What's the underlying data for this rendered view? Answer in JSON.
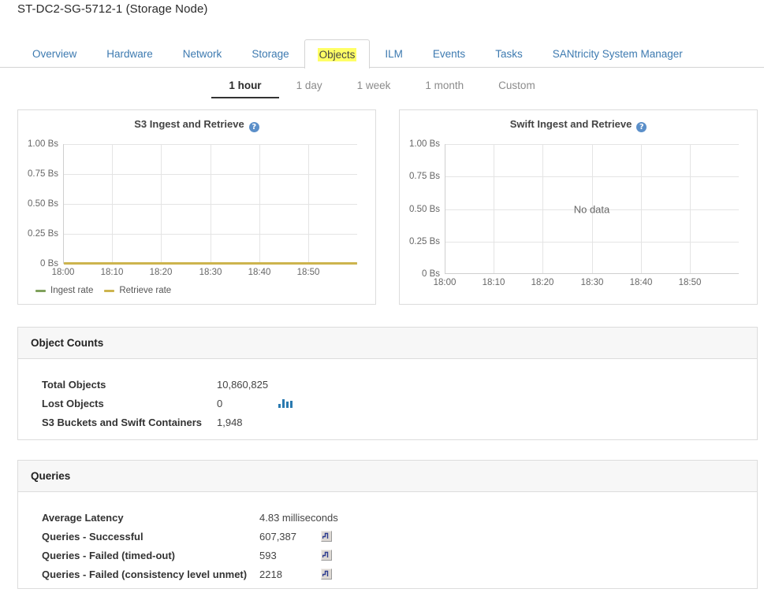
{
  "page": {
    "node_title": "ST-DC2-SG-5712-1 (Storage Node)"
  },
  "tabs": [
    {
      "label": "Overview",
      "active": false
    },
    {
      "label": "Hardware",
      "active": false
    },
    {
      "label": "Network",
      "active": false
    },
    {
      "label": "Storage",
      "active": false
    },
    {
      "label": "Objects",
      "active": true
    },
    {
      "label": "ILM",
      "active": false
    },
    {
      "label": "Events",
      "active": false
    },
    {
      "label": "Tasks",
      "active": false
    },
    {
      "label": "SANtricity System Manager",
      "active": false
    }
  ],
  "time_range": {
    "options": [
      {
        "label": "1 hour",
        "active": true
      },
      {
        "label": "1 day",
        "active": false
      },
      {
        "label": "1 week",
        "active": false
      },
      {
        "label": "1 month",
        "active": false
      },
      {
        "label": "Custom",
        "active": false
      }
    ]
  },
  "chart_data": [
    {
      "type": "line",
      "title": "S3 Ingest and Retrieve",
      "help_glyph": "?",
      "xlabel": "",
      "ylabel": "",
      "ylim": [
        0,
        1
      ],
      "yticks": [
        "0 Bs",
        "0.25 Bs",
        "0.50 Bs",
        "0.75 Bs",
        "1.00 Bs"
      ],
      "ytick_values": [
        0,
        0.25,
        0.5,
        0.75,
        1.0
      ],
      "xticks": [
        "18:00",
        "18:10",
        "18:20",
        "18:30",
        "18:40",
        "18:50"
      ],
      "xtick_positions": [
        0,
        0.167,
        0.333,
        0.5,
        0.667,
        0.833
      ],
      "grid": true,
      "legend_position": "bottom-left",
      "series": [
        {
          "name": "Ingest rate",
          "color": "#7fa15c",
          "values": [
            0,
            0,
            0,
            0,
            0,
            0,
            0
          ]
        },
        {
          "name": "Retrieve rate",
          "color": "#cdb44e",
          "values": [
            0,
            0,
            0,
            0,
            0,
            0,
            0
          ]
        }
      ],
      "no_data": false
    },
    {
      "type": "line",
      "title": "Swift Ingest and Retrieve",
      "help_glyph": "?",
      "xlabel": "",
      "ylabel": "",
      "ylim": [
        0,
        1
      ],
      "yticks": [
        "0 Bs",
        "0.25 Bs",
        "0.50 Bs",
        "0.75 Bs",
        "1.00 Bs"
      ],
      "ytick_values": [
        0,
        0.25,
        0.5,
        0.75,
        1.0
      ],
      "xticks": [
        "18:00",
        "18:10",
        "18:20",
        "18:30",
        "18:40",
        "18:50"
      ],
      "xtick_positions": [
        0,
        0.167,
        0.333,
        0.5,
        0.667,
        0.833
      ],
      "grid": true,
      "legend_position": "none",
      "series": [],
      "no_data": true,
      "no_data_text": "No data"
    }
  ],
  "object_counts": {
    "title": "Object Counts",
    "rows": [
      {
        "label": "Total Objects",
        "value": "10,860,825",
        "icon": ""
      },
      {
        "label": "Lost Objects",
        "value": "0",
        "icon": "bar-chart-icon"
      },
      {
        "label": "S3 Buckets and Swift Containers",
        "value": "1,948",
        "icon": ""
      }
    ]
  },
  "queries": {
    "title": "Queries",
    "rows": [
      {
        "label": "Average Latency",
        "value": "4.83 milliseconds",
        "icon": ""
      },
      {
        "label": "Queries - Successful",
        "value": "607,387",
        "icon": "step-chart-icon"
      },
      {
        "label": "Queries - Failed (timed-out)",
        "value": "593",
        "icon": "step-chart-icon"
      },
      {
        "label": "Queries - Failed (consistency level unmet)",
        "value": "2218",
        "icon": "step-chart-icon"
      }
    ]
  },
  "colors": {
    "link": "#3d7ab0",
    "highlight": "#ffff66",
    "ingest": "#7fa15c",
    "retrieve": "#cdb44e",
    "accent": "#2a7ab0"
  }
}
